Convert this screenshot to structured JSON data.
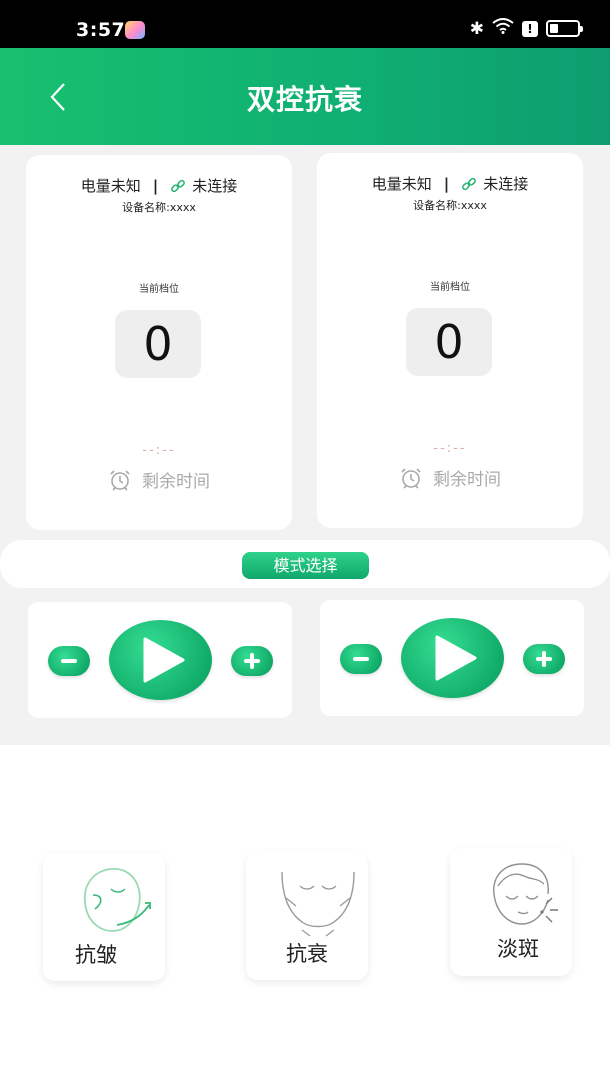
{
  "status_bar": {
    "time": "3:57",
    "icons": [
      "bluetooth-icon",
      "wifi-icon",
      "alert-icon",
      "battery-icon"
    ]
  },
  "header": {
    "back_icon": "chevron-left-icon",
    "title": "双控抗衰"
  },
  "devices": [
    {
      "battery_text": "电量未知",
      "separator": "|",
      "connection_text": "未连接",
      "device_name": "设备名称:xxxx",
      "level_label": "当前档位",
      "level_value": "0",
      "time_display": "--:--",
      "remaining_label": "剩余时间"
    },
    {
      "battery_text": "电量未知",
      "separator": "|",
      "connection_text": "未连接",
      "device_name": "设备名称:xxxx",
      "level_label": "当前档位",
      "level_value": "0",
      "time_display": "--:--",
      "remaining_label": "剩余时间"
    }
  ],
  "mode": {
    "button_label": "模式选择"
  },
  "controls": [
    {
      "minus_icon": "minus-icon",
      "play_icon": "play-icon",
      "plus_icon": "plus-icon"
    },
    {
      "minus_icon": "minus-icon",
      "play_icon": "play-icon",
      "plus_icon": "plus-icon"
    }
  ],
  "features": [
    {
      "label": "抗皱",
      "icon": "face-anti-wrinkle-icon"
    },
    {
      "label": "抗衰",
      "icon": "face-anti-aging-icon"
    },
    {
      "label": "淡斑",
      "icon": "face-spot-fading-icon"
    }
  ],
  "colors": {
    "brand_green": "#12b06e",
    "header_gradient_start": "#18c06f",
    "header_gradient_end": "#0e9d6f",
    "panel_gray": "#f2f2f2"
  }
}
